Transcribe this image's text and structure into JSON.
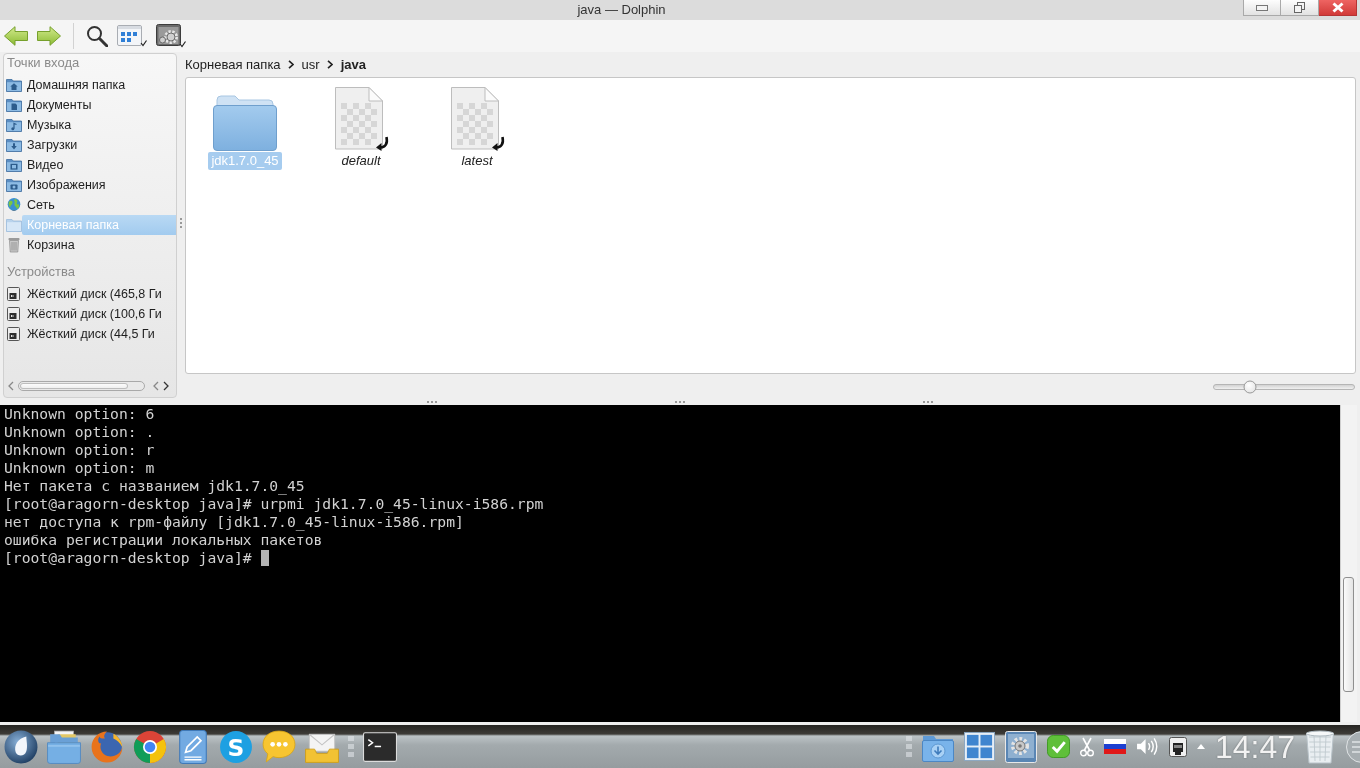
{
  "window": {
    "title": "java — Dolphin"
  },
  "places": {
    "sections": [
      {
        "title": "Точки входа",
        "items": [
          {
            "label": "Домашняя папка",
            "kind": "home",
            "selected": false
          },
          {
            "label": "Документы",
            "kind": "documents",
            "selected": false
          },
          {
            "label": "Музыка",
            "kind": "music",
            "selected": false
          },
          {
            "label": "Загрузки",
            "kind": "downloads",
            "selected": false
          },
          {
            "label": "Видео",
            "kind": "videos",
            "selected": false
          },
          {
            "label": "Изображения",
            "kind": "pictures",
            "selected": false
          },
          {
            "label": "Сеть",
            "kind": "network",
            "selected": false
          },
          {
            "label": "Корневая папка",
            "kind": "root",
            "selected": true
          },
          {
            "label": "Корзина",
            "kind": "trash",
            "selected": false
          }
        ]
      },
      {
        "title": "Устройства",
        "items": [
          {
            "label": "Жёсткий диск (465,8 Ги",
            "kind": "disk",
            "selected": false
          },
          {
            "label": "Жёсткий диск (100,6 Ги",
            "kind": "disk",
            "selected": false
          },
          {
            "label": "Жёсткий диск (44,5 Ги",
            "kind": "disk",
            "selected": false
          }
        ]
      }
    ]
  },
  "breadcrumb": [
    {
      "label": "Корневая папка",
      "current": false
    },
    {
      "label": "usr",
      "current": false
    },
    {
      "label": "java",
      "current": true
    }
  ],
  "files": [
    {
      "name": "jdk1.7.0_45",
      "kind": "folder",
      "selected": true
    },
    {
      "name": "default",
      "kind": "link",
      "selected": false
    },
    {
      "name": "latest",
      "kind": "link",
      "selected": false
    }
  ],
  "zoom_slider": {
    "level": 0.26
  },
  "terminal": {
    "lines": [
      "Unknown option: 6",
      "Unknown option: .",
      "Unknown option: r",
      "Unknown option: m",
      "Нет пакета с названием jdk1.7.0_45",
      "[root@aragorn-desktop java]# urpmi jdk1.7.0_45-linux-i586.rpm",
      "нет доступа к rpm-файлу [jdk1.7.0_45-linux-i586.rpm]",
      "ошибка регистрации локальных пакетов",
      "[root@aragorn-desktop java]#"
    ],
    "cursor": true
  },
  "taskbar": {
    "chat_app_letter": "S",
    "clock": "14:47"
  }
}
